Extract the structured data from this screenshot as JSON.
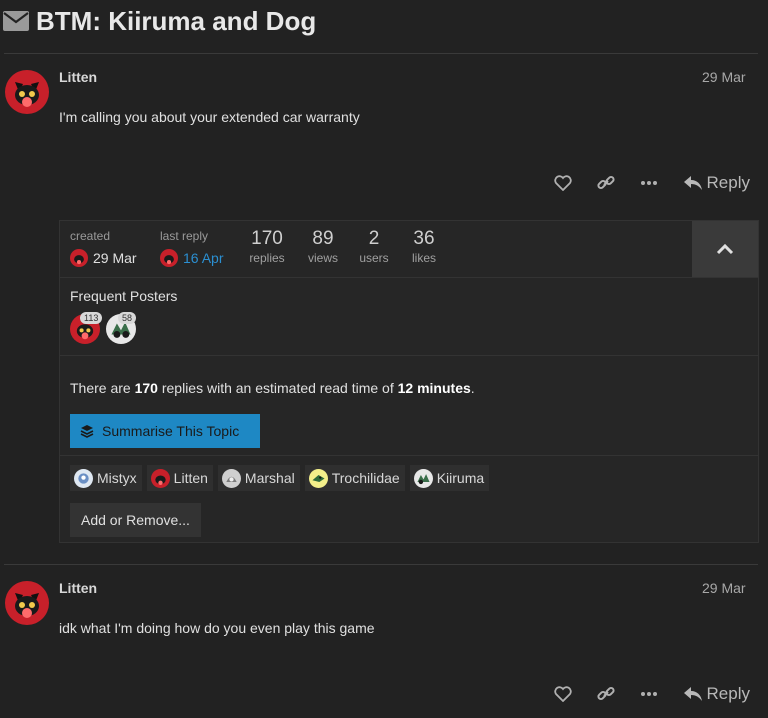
{
  "topic": {
    "title": "BTM: Kiiruma and Dog"
  },
  "posts": [
    {
      "username": "Litten",
      "date": "29 Mar",
      "body": "I'm calling you about your extended car warranty",
      "reply_label": "Reply"
    },
    {
      "username": "Litten",
      "date": "29 Mar",
      "body": "idk what I'm doing how do you even play this game",
      "reply_label": "Reply"
    }
  ],
  "topic_map": {
    "created_label": "created",
    "created_date": "29 Mar",
    "last_reply_label": "last reply",
    "last_reply_date": "16 Apr",
    "stats": [
      {
        "value": "170",
        "label": "replies"
      },
      {
        "value": "89",
        "label": "views"
      },
      {
        "value": "2",
        "label": "users"
      },
      {
        "value": "36",
        "label": "likes"
      }
    ],
    "frequent_posters_label": "Frequent Posters",
    "frequent_posters": [
      {
        "count": "113"
      },
      {
        "count": "58"
      }
    ],
    "read_time": {
      "prefix": "There are ",
      "replies": "170",
      "middle": " replies with an estimated read time of ",
      "minutes": "12 minutes",
      "suffix": "."
    },
    "summarise_label": "Summarise This Topic",
    "participants": [
      "Mistyx",
      "Litten",
      "Marshal",
      "Trochilidae",
      "Kiiruma"
    ],
    "add_remove_label": "Add or Remove..."
  },
  "colors": {
    "background": "#222222",
    "accent_blue": "#2b8fd1",
    "button_blue": "#1e88c4"
  }
}
